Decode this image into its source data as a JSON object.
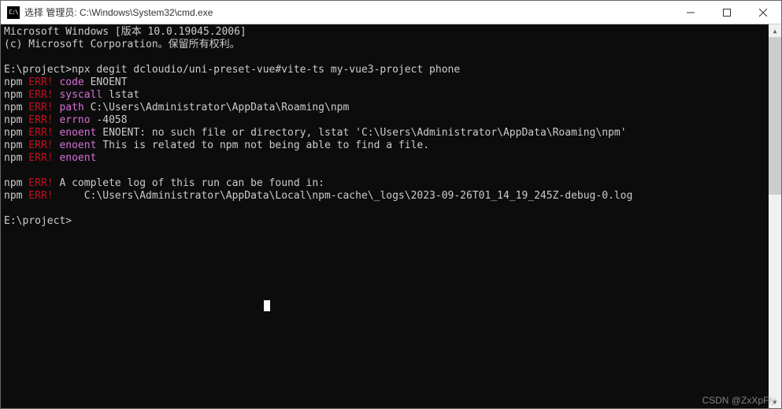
{
  "titlebar": {
    "icon_text": "C:\\",
    "title": "选择 管理员: C:\\Windows\\System32\\cmd.exe"
  },
  "terminal": {
    "header1": "Microsoft Windows [版本 10.0.19045.2006]",
    "header2": "(c) Microsoft Corporation。保留所有权利。",
    "prompt1_path": "E:\\project>",
    "prompt1_cmd": "npx degit dcloudio/uni-preset-vue#vite-ts my-vue3-project phone",
    "npm": "npm",
    "err": " ERR!",
    "l1_key": " code",
    "l1_val": " ENOENT",
    "l2_key": " syscall",
    "l2_val": " lstat",
    "l3_key": " path",
    "l3_val": " C:\\Users\\Administrator\\AppData\\Roaming\\npm",
    "l4_key": " errno",
    "l4_val": " -4058",
    "l5_key": " enoent",
    "l5_val": " ENOENT: no such file or directory, lstat 'C:\\Users\\Administrator\\AppData\\Roaming\\npm'",
    "l6_key": " enoent",
    "l6_val": " This is related to npm not being able to find a file.",
    "l7_key": " enoent",
    "l8_val": " A complete log of this run can be found in:",
    "l9_val": "     C:\\Users\\Administrator\\AppData\\Local\\npm-cache\\_logs\\2023-09-26T01_14_19_245Z-debug-0.log",
    "prompt2_path": "E:\\project>"
  },
  "watermark": "CSDN @ZxXpFly"
}
